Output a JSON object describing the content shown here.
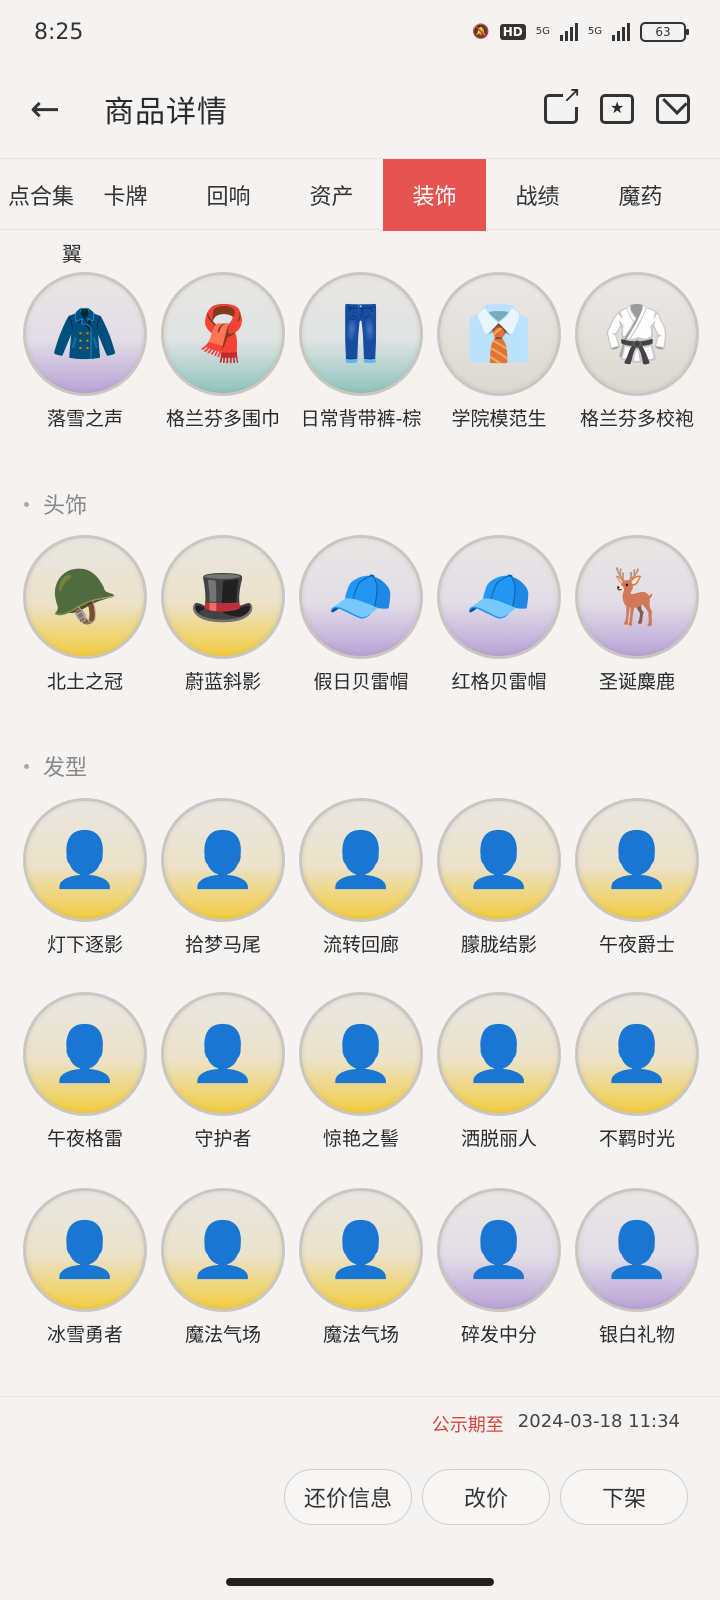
{
  "status_bar": {
    "time": "8:25",
    "battery": "63",
    "hd": "HD",
    "net1": "5G",
    "net2": "5G"
  },
  "header": {
    "title": "商品详情"
  },
  "tabs": [
    {
      "label": "点合集"
    },
    {
      "label": "卡牌"
    },
    {
      "label": "回响"
    },
    {
      "label": "资产"
    },
    {
      "label": "装饰",
      "active": true
    },
    {
      "label": "战绩"
    },
    {
      "label": "魔药"
    }
  ],
  "cut_label": "翼",
  "outfits": [
    {
      "name": "落雪之声",
      "tier": "purple",
      "icon": "sweater-icon"
    },
    {
      "name": "格兰芬多围巾",
      "tier": "teal",
      "icon": "scarf-icon"
    },
    {
      "name": "日常背带裤-棕",
      "tier": "teal",
      "icon": "overalls-icon"
    },
    {
      "name": "学院模范生",
      "tier": "grey",
      "icon": "shirt-icon"
    },
    {
      "name": "格兰芬多校袍",
      "tier": "grey",
      "icon": "robe-icon"
    }
  ],
  "headwear_section": "头饰",
  "headwear": [
    {
      "name": "北土之冠",
      "tier": "gold",
      "icon": "hat-icon"
    },
    {
      "name": "蔚蓝斜影",
      "tier": "gold",
      "icon": "hat-icon"
    },
    {
      "name": "假日贝雷帽",
      "tier": "purple",
      "icon": "beret-icon"
    },
    {
      "name": "红格贝雷帽",
      "tier": "purple",
      "icon": "beret-icon"
    },
    {
      "name": "圣诞麋鹿",
      "tier": "purple",
      "icon": "reindeer-hat-icon"
    }
  ],
  "hair_section": "发型",
  "hair": [
    {
      "name": "灯下逐影",
      "tier": "gold"
    },
    {
      "name": "拾梦马尾",
      "tier": "gold"
    },
    {
      "name": "流转回廊",
      "tier": "gold"
    },
    {
      "name": "朦胧结影",
      "tier": "gold"
    },
    {
      "name": "午夜爵士",
      "tier": "gold"
    },
    {
      "name": "午夜格雷",
      "tier": "gold"
    },
    {
      "name": "守护者",
      "tier": "gold"
    },
    {
      "name": "惊艳之髻",
      "tier": "gold"
    },
    {
      "name": "洒脱丽人",
      "tier": "gold"
    },
    {
      "name": "不羁时光",
      "tier": "gold"
    },
    {
      "name": "冰雪勇者",
      "tier": "gold"
    },
    {
      "name": "魔法气场",
      "tier": "gold"
    },
    {
      "name": "魔法气场",
      "tier": "gold"
    },
    {
      "name": "碎发中分",
      "tier": "purple"
    },
    {
      "name": "银白礼物",
      "tier": "purple"
    }
  ],
  "footer": {
    "deadline_label": "公示期至",
    "deadline_value": "2024-03-18 11:34",
    "buttons": [
      "还价信息",
      "改价",
      "下架"
    ]
  }
}
